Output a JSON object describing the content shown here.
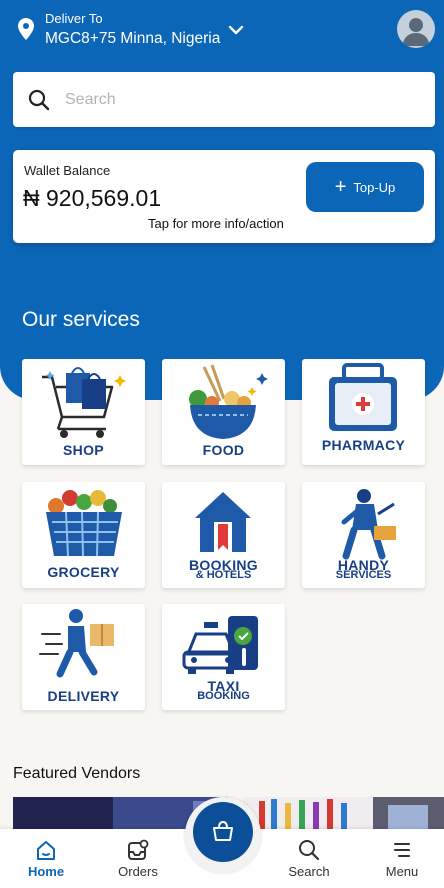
{
  "header": {
    "deliver_label": "Deliver To",
    "address": "MGC8+75 Minna, Nigeria"
  },
  "search": {
    "placeholder": "Search"
  },
  "wallet": {
    "label": "Wallet Balance",
    "amount": "₦ 920,569.01",
    "info": "Tap for more info/action",
    "topup_label": "Top-Up"
  },
  "services": {
    "title": "Our services",
    "items": [
      {
        "label": "SHOP",
        "icon": "shopping-cart-icon"
      },
      {
        "label": "FOOD",
        "icon": "food-bowl-icon"
      },
      {
        "label": "PHARMACY",
        "icon": "first-aid-kit-icon"
      },
      {
        "label": "GROCERY",
        "icon": "grocery-basket-icon"
      },
      {
        "label": "BOOKING",
        "sublabel": "& HOTELS",
        "icon": "hotel-icon"
      },
      {
        "label": "HANDY",
        "sublabel": "SERVICES",
        "icon": "handyman-icon"
      },
      {
        "label": "DELIVERY",
        "icon": "courier-icon"
      },
      {
        "label": "TAXI",
        "sublabel": "BOOKING",
        "icon": "taxi-icon"
      }
    ]
  },
  "featured": {
    "title": "Featured Vendors"
  },
  "nav": {
    "items": [
      {
        "label": "Home",
        "icon": "home-icon",
        "active": true
      },
      {
        "label": "Orders",
        "icon": "orders-icon"
      },
      {
        "label": "Search",
        "icon": "search-icon"
      },
      {
        "label": "Menu",
        "icon": "menu-icon"
      }
    ],
    "center_icon": "shopping-bag-icon"
  },
  "colors": {
    "primary": "#0c66b8",
    "navy": "#183f86",
    "background": "#f8f6f2"
  }
}
